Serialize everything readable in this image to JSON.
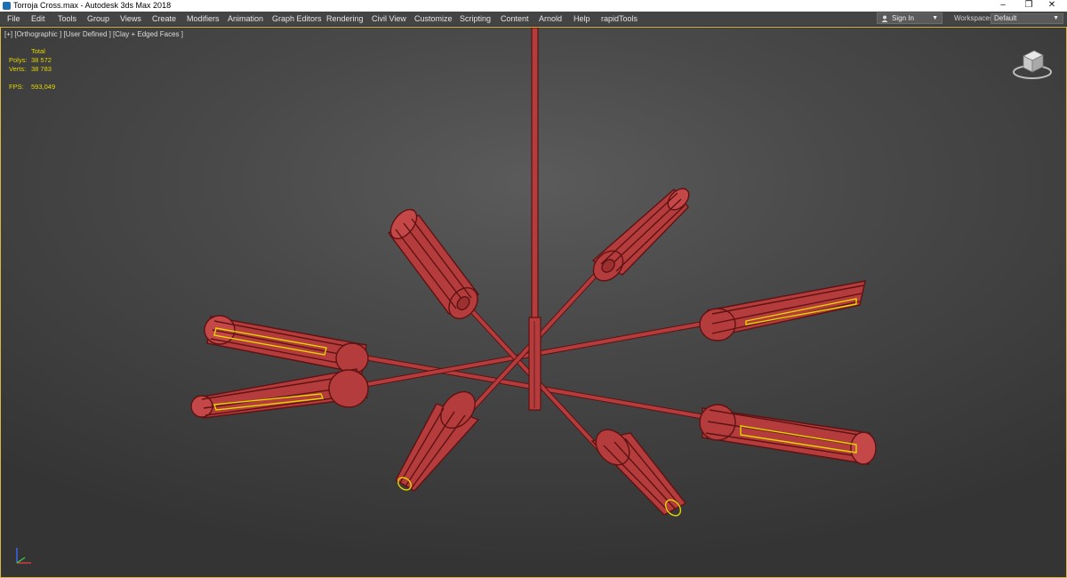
{
  "window": {
    "title": "Torroja Cross.max - Autodesk 3ds Max 2018",
    "controls": {
      "minimize": "–",
      "restore": "❐",
      "close": "✕"
    }
  },
  "menu": {
    "items": [
      "File",
      "Edit",
      "Tools",
      "Group",
      "Views",
      "Create",
      "Modifiers",
      "Animation",
      "Graph Editors",
      "Rendering",
      "Civil View",
      "Customize",
      "Scripting",
      "Content",
      "Arnold",
      "Help",
      "rapidTools"
    ],
    "sign_in": "Sign In",
    "workspaces_label": "Workspaces:",
    "workspace_value": "Default"
  },
  "viewport": {
    "label": "[+] [Orthographic ] [User Defined ] [Clay + Edged Faces ]",
    "stats": {
      "header": "Total",
      "polys_label": "Polys:",
      "polys_value": "38 572",
      "verts_label": "Verts:",
      "verts_value": "38 783",
      "fps_label": "FPS:",
      "fps_value": "593,049"
    }
  },
  "colors": {
    "model": "#b43c3c",
    "wire": "#5e1212",
    "selection": "#e3d500",
    "viewport_border": "#d7b64a"
  },
  "icons": {
    "app": "3ds-max-icon",
    "user": "user-icon",
    "viewcube": "viewcube-icon",
    "axis": "axis-tripod-icon"
  }
}
